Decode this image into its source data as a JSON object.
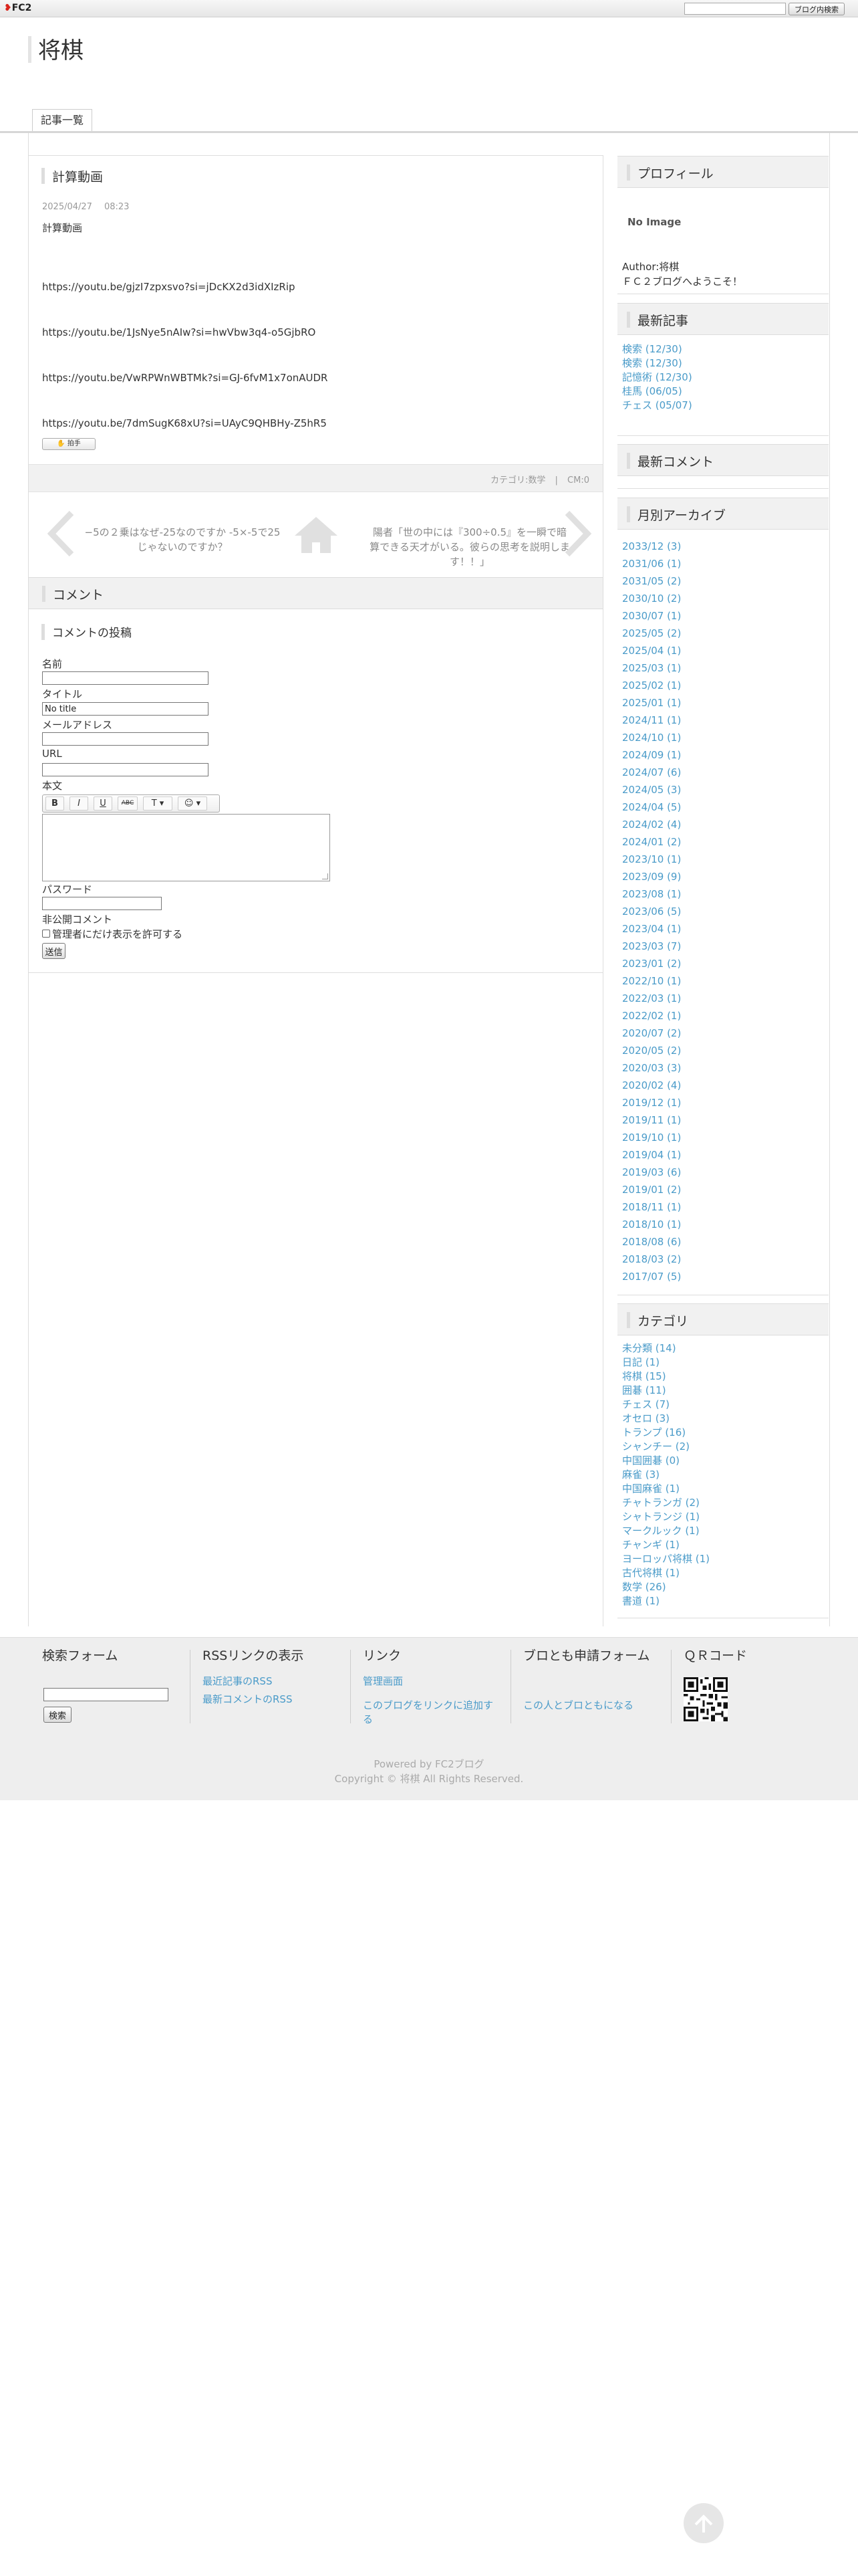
{
  "topbar": {
    "logo_text": "FC2",
    "search_button_label": "ブログ内検索"
  },
  "blog": {
    "title": "将棋",
    "nav_tab_label": "記事一覧"
  },
  "entry": {
    "title": "計算動画",
    "date": "2025/04/27",
    "time": "08:23",
    "body_first_line": "計算動画",
    "links": [
      "https://youtu.be/gjzI7zpxsvo?si=jDcKX2d3idXIzRip",
      "https://youtu.be/1JsNye5nAIw?si=hwVbw3q4-o5GjbRO",
      "https://youtu.be/VwRPWnWBTMk?si=GJ-6fvM1x7onAUDR",
      "https://youtu.be/7dmSugK68xU?si=UAyC9QHBHy-Z5hR5"
    ],
    "clap_label": "拍手",
    "footer_category": "カテゴリ:数学",
    "footer_separator": "|",
    "footer_comments": "CM:0"
  },
  "pager": {
    "prev_text": "−5の２乗はなぜ-25なのですか -5×-5で25 じゃないのですか？",
    "next_text": "陽者「世の中には『300÷0.5』を一瞬で暗算できる天才がいる。彼らの思考を説明します！！」"
  },
  "comments": {
    "section_title": "コメント",
    "post_title": "コメントの投稿",
    "name_label": "名前",
    "title_label": "タイトル",
    "title_value": "No title",
    "email_label": "メールアドレス",
    "url_label": "URL",
    "body_label": "本文",
    "toolbar": [
      "B",
      "I",
      "U",
      "ABC",
      "T ▾",
      "☺ ▾"
    ],
    "password_label": "パスワード",
    "private_label": "非公開コメント",
    "private_checkbox_label": "管理者にだけ表示を許可する",
    "submit_label": "送信"
  },
  "sidebar": {
    "profile": {
      "title": "プロフィール",
      "no_image": "No Image",
      "author": "Author:将棋",
      "greeting": "ＦＣ２ブログへようこそ！"
    },
    "recent_entries": {
      "title": "最新記事",
      "items": [
        "検索 (12/30)",
        "検索 (12/30)",
        "記憶術 (12/30)",
        "桂馬 (06/05)",
        "チェス (05/07)"
      ]
    },
    "recent_comments": {
      "title": "最新コメント"
    },
    "archives": {
      "title": "月別アーカイブ",
      "items": [
        "2033/12 (3)",
        "2031/06 (1)",
        "2031/05 (2)",
        "2030/10 (2)",
        "2030/07 (1)",
        "2025/05 (2)",
        "2025/04 (1)",
        "2025/03 (1)",
        "2025/02 (1)",
        "2025/01 (1)",
        "2024/11 (1)",
        "2024/10 (1)",
        "2024/09 (1)",
        "2024/07 (6)",
        "2024/05 (3)",
        "2024/04 (5)",
        "2024/02 (4)",
        "2024/01 (2)",
        "2023/10 (1)",
        "2023/09 (9)",
        "2023/08 (1)",
        "2023/06 (5)",
        "2023/04 (1)",
        "2023/03 (7)",
        "2023/01 (2)",
        "2022/10 (1)",
        "2022/03 (1)",
        "2022/02 (1)",
        "2020/07 (2)",
        "2020/05 (2)",
        "2020/03 (3)",
        "2020/02 (4)",
        "2019/12 (1)",
        "2019/11 (1)",
        "2019/10 (1)",
        "2019/04 (1)",
        "2019/03 (6)",
        "2019/01 (2)",
        "2018/11 (1)",
        "2018/10 (1)",
        "2018/08 (6)",
        "2018/03 (2)",
        "2017/07 (5)"
      ]
    },
    "categories": {
      "title": "カテゴリ",
      "items": [
        "未分類 (14)",
        "日記 (1)",
        "将棋 (15)",
        "囲碁 (11)",
        "チェス (7)",
        "オセロ (3)",
        "トランプ (16)",
        "シャンチー (2)",
        "中国囲碁 (0)",
        "麻雀 (3)",
        "中国麻雀 (1)",
        "チャトランガ (2)",
        "シャトランジ (1)",
        "マークルック (1)",
        "チャンギ (1)",
        "ヨーロッパ将棋 (1)",
        "古代将棋 (1)",
        "数学 (26)",
        "書道 (1)"
      ]
    }
  },
  "footer": {
    "search": {
      "title": "検索フォーム",
      "button_label": "検索"
    },
    "rss": {
      "title": "RSSリンクの表示",
      "links": [
        "最近記事のRSS",
        "最新コメントのRSS"
      ]
    },
    "links": {
      "title": "リンク",
      "items": [
        "管理画面",
        "このブログをリンクに追加する"
      ]
    },
    "friend": {
      "title": "ブロとも申請フォーム",
      "link": "この人とブロともになる"
    },
    "qr": {
      "title": "ＱＲコード"
    },
    "powered": "Powered by FC2ブログ",
    "copyright": "Copyright © 将棋 All Rights Reserved."
  }
}
